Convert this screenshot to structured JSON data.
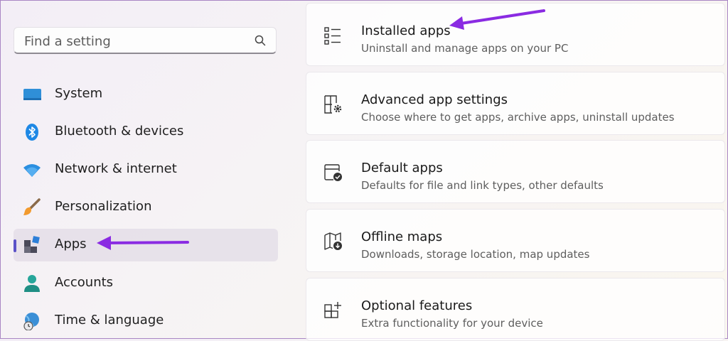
{
  "search": {
    "placeholder": "Find a setting"
  },
  "sidebar": {
    "items": [
      {
        "label": "System",
        "icon": "monitor-icon",
        "selected": false
      },
      {
        "label": "Bluetooth & devices",
        "icon": "bluetooth-icon",
        "selected": false
      },
      {
        "label": "Network & internet",
        "icon": "wifi-icon",
        "selected": false
      },
      {
        "label": "Personalization",
        "icon": "paintbrush-icon",
        "selected": false
      },
      {
        "label": "Apps",
        "icon": "apps-icon",
        "selected": true
      },
      {
        "label": "Accounts",
        "icon": "person-icon",
        "selected": false
      },
      {
        "label": "Time & language",
        "icon": "globe-clock-icon",
        "selected": false
      }
    ]
  },
  "main": {
    "cards": [
      {
        "title": "Installed apps",
        "subtitle": "Uninstall and manage apps on your PC",
        "icon": "app-list-icon"
      },
      {
        "title": "Advanced app settings",
        "subtitle": "Choose where to get apps, archive apps, uninstall updates",
        "icon": "app-settings-icon"
      },
      {
        "title": "Default apps",
        "subtitle": "Defaults for file and link types, other defaults",
        "icon": "default-apps-icon"
      },
      {
        "title": "Offline maps",
        "subtitle": "Downloads, storage location, map updates",
        "icon": "offline-map-icon"
      },
      {
        "title": "Optional features",
        "subtitle": "Extra functionality for your device",
        "icon": "optional-features-icon"
      }
    ]
  },
  "colors": {
    "accent": "#5b52c8",
    "annotation_arrow": "#8a2be2",
    "selected_bg": "#e4dee8"
  }
}
